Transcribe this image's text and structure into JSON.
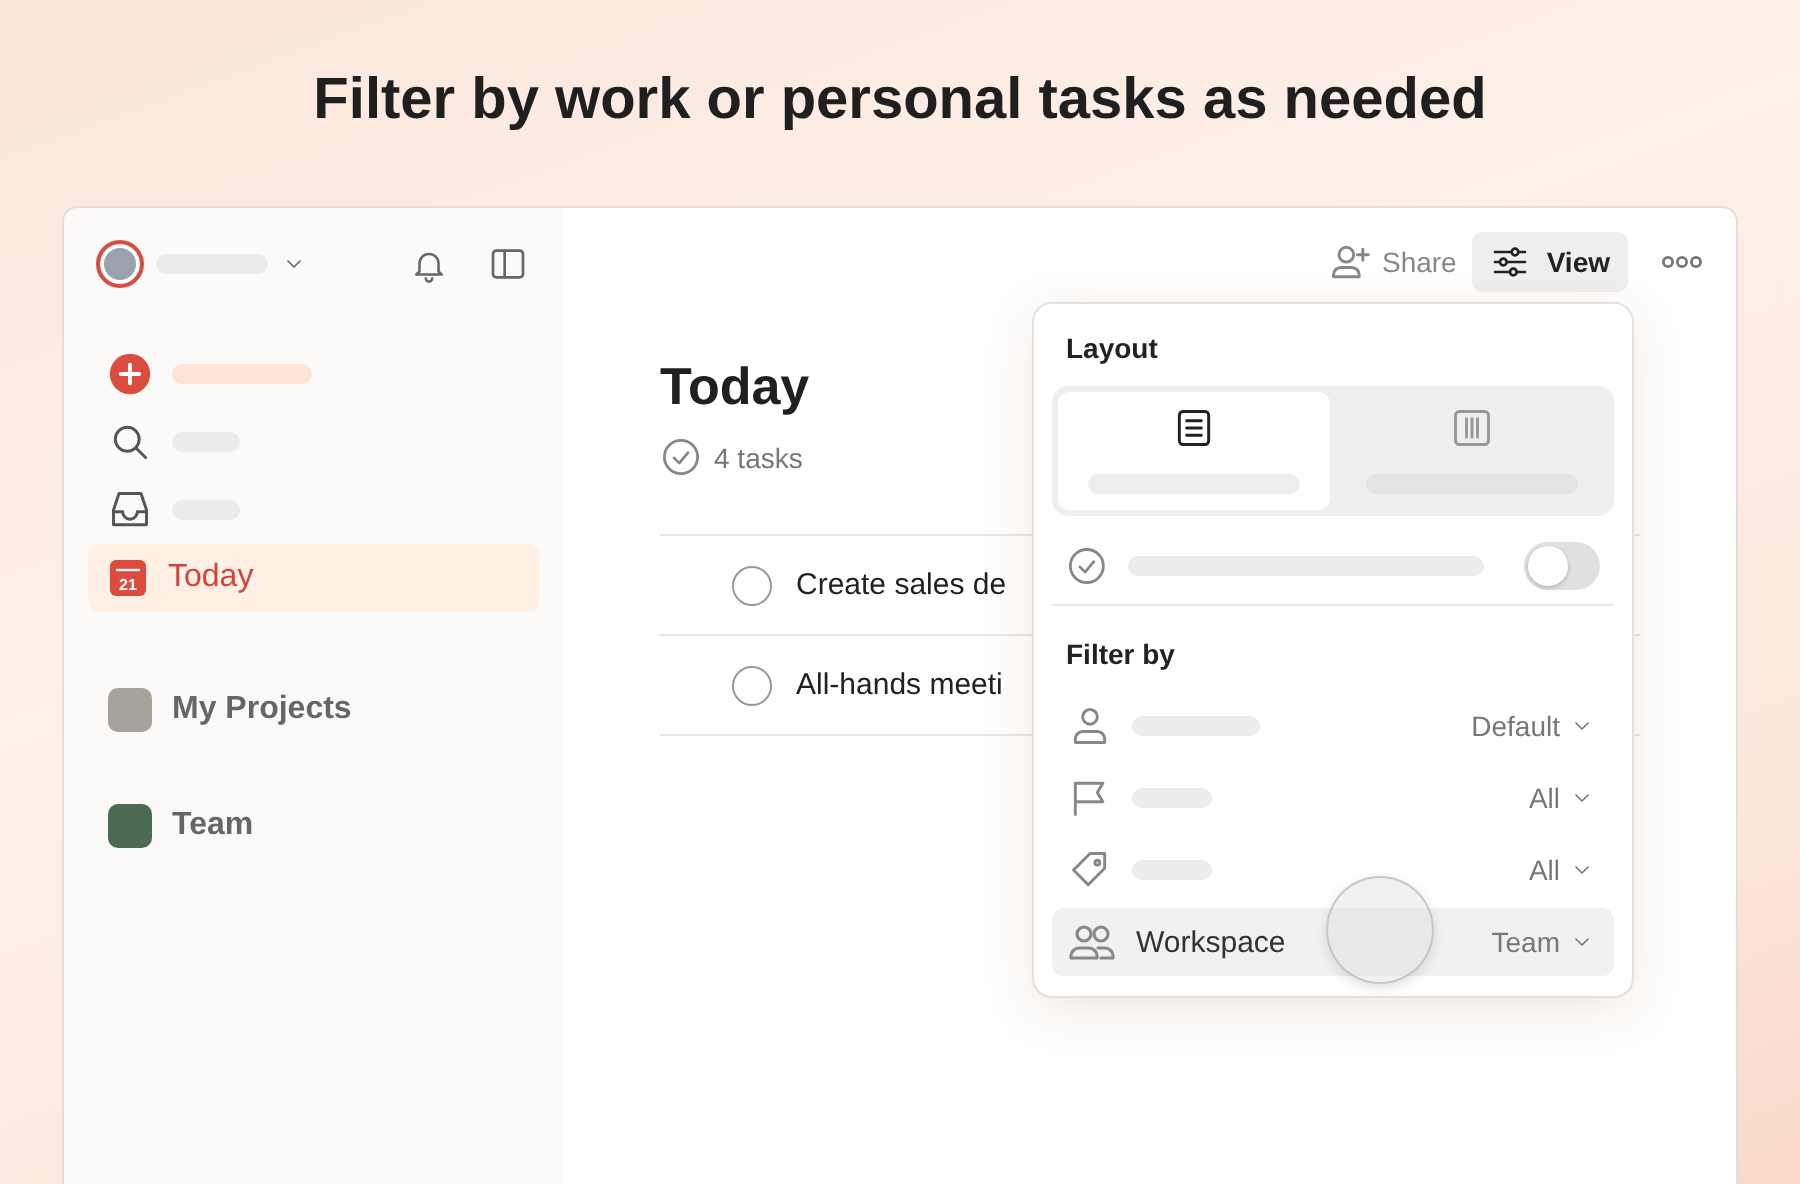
{
  "headline": "Filter by work or personal tasks as needed",
  "sidebar": {
    "nav": [
      {
        "selected": false
      },
      {
        "selected": false
      },
      {
        "selected": false
      },
      {
        "label": "Today",
        "date": "21",
        "selected": true
      }
    ],
    "projects": [
      {
        "label": "My Projects"
      },
      {
        "label": "Team"
      }
    ]
  },
  "toolbar": {
    "share": "Share",
    "view": "View"
  },
  "page": {
    "title": "Today",
    "count": "4 tasks"
  },
  "tasks": [
    {
      "title": "Create sales de",
      "checked": false
    },
    {
      "title": "All-hands meeti",
      "checked": false
    }
  ],
  "view_menu": {
    "layout_title": "Layout",
    "layouts": [
      {
        "selected": true
      },
      {
        "selected": false
      }
    ],
    "toggle": {
      "on": false
    },
    "filter_title": "Filter by",
    "filters": [
      {
        "value": "Default",
        "selected": false
      },
      {
        "value": "All",
        "selected": false
      },
      {
        "value": "All",
        "selected": false
      },
      {
        "label": "Workspace",
        "value": "Team",
        "selected": true
      }
    ]
  }
}
